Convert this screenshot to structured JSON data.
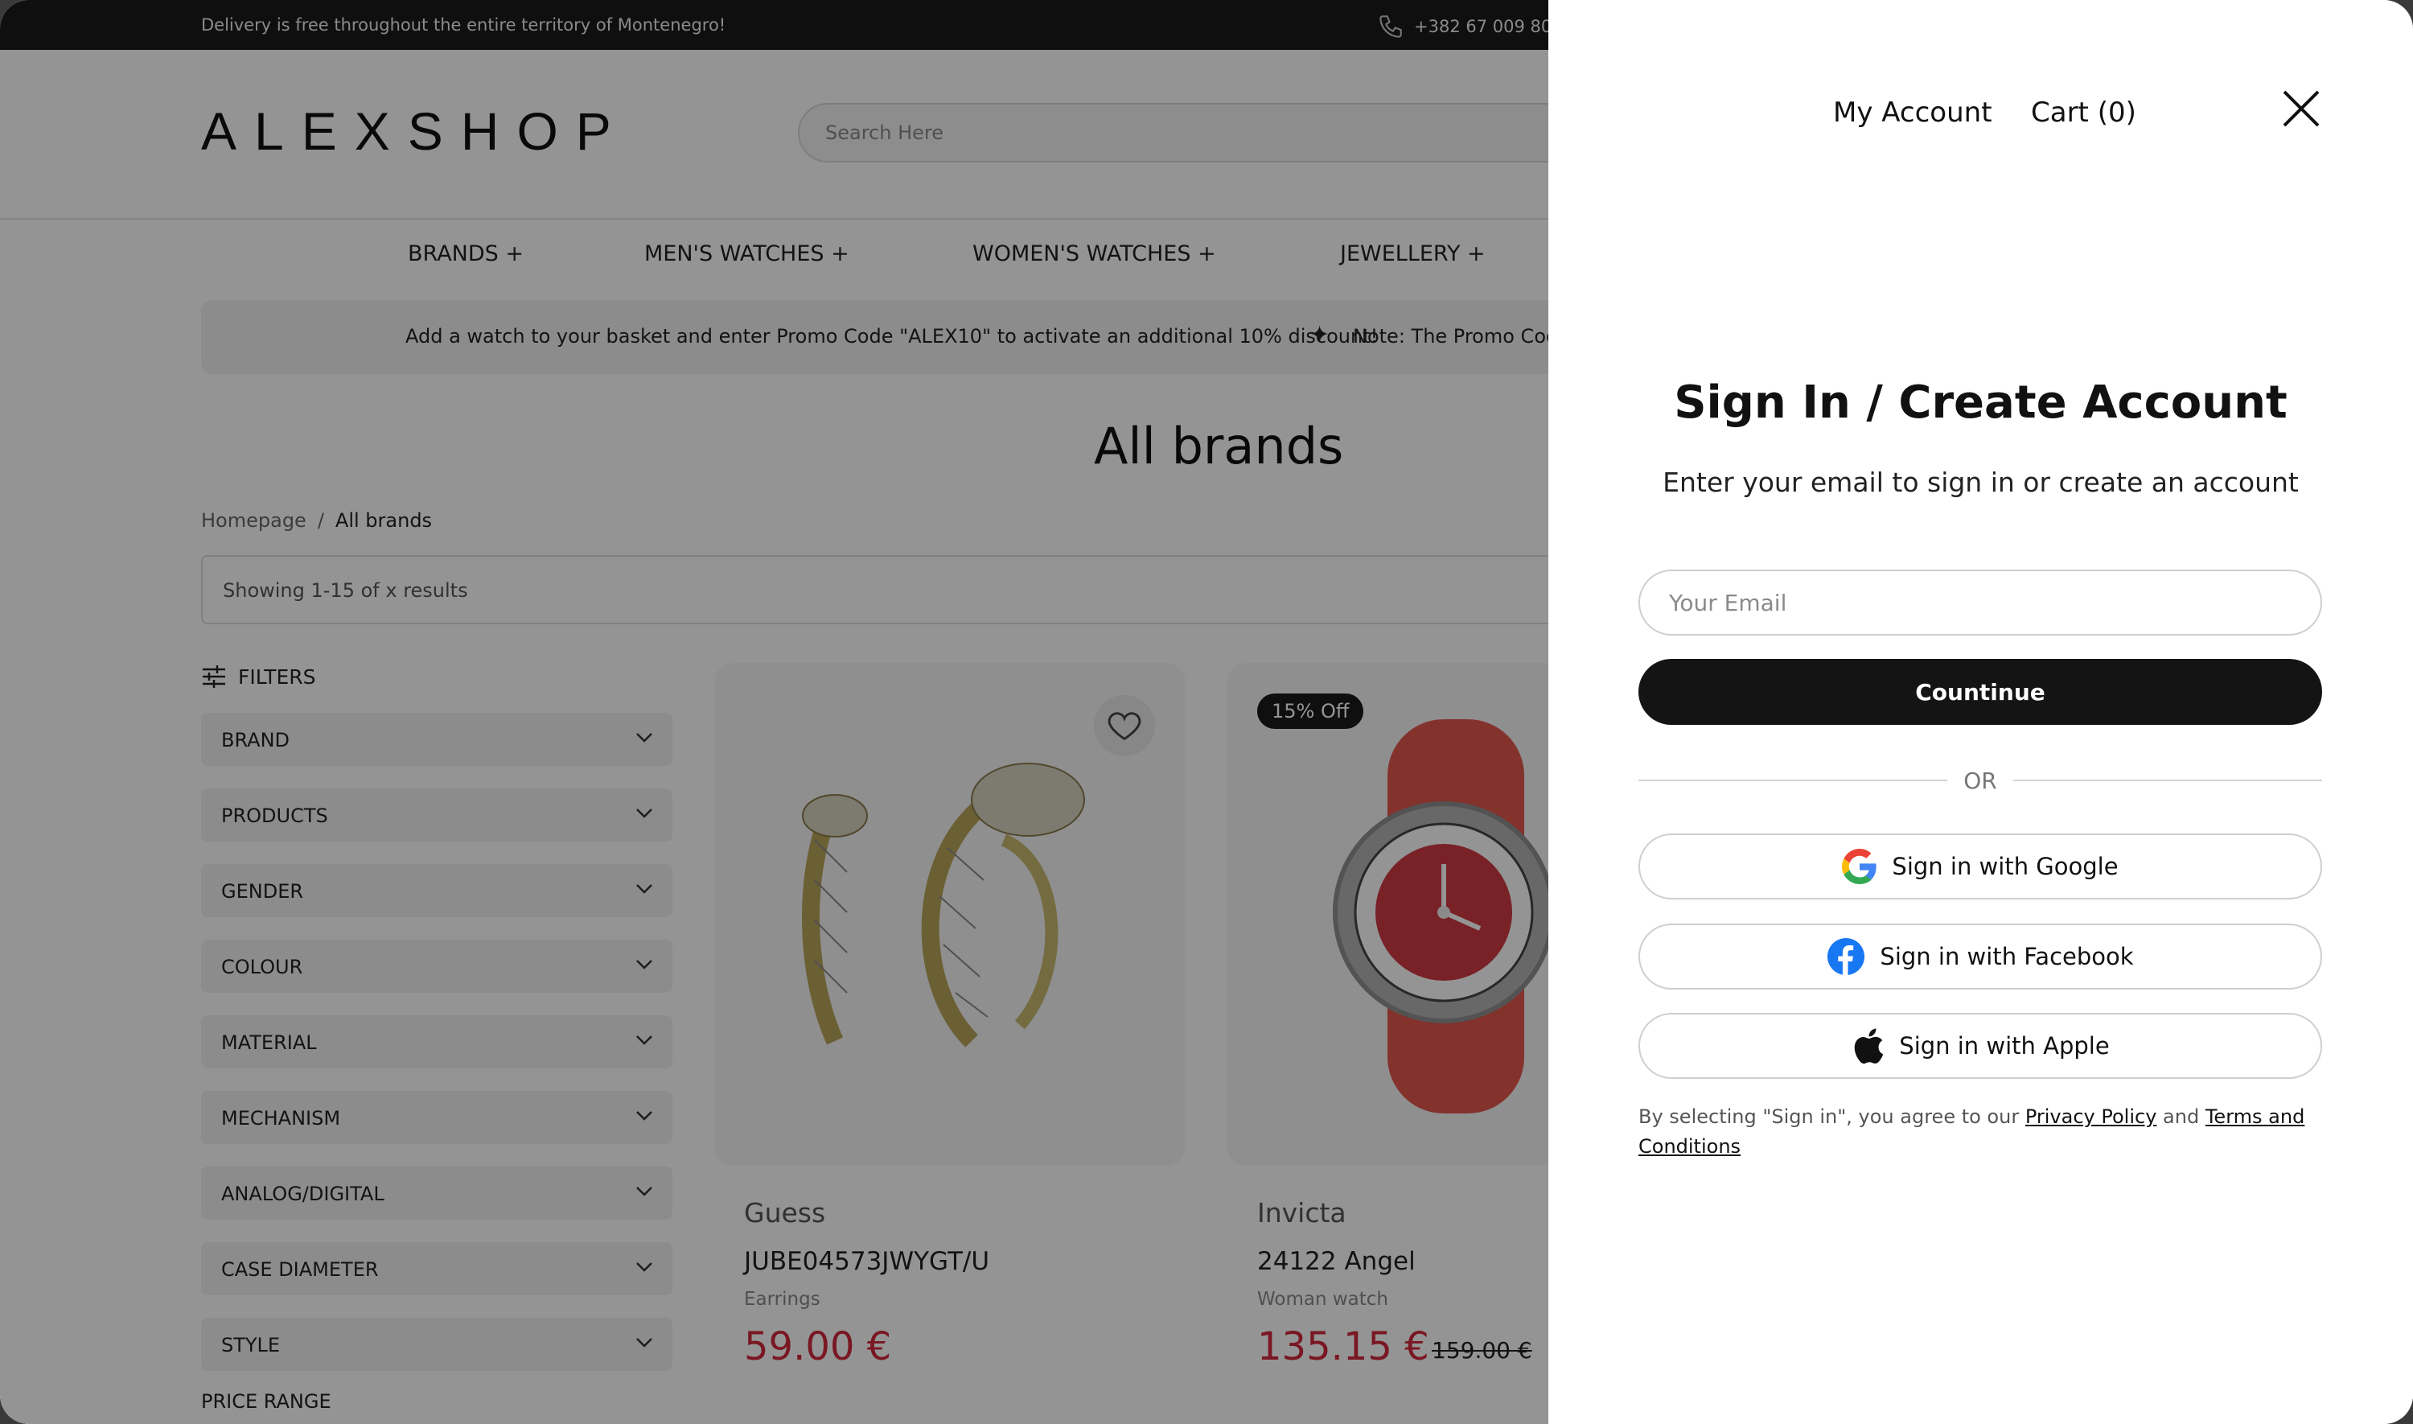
{
  "topbar": {
    "delivery": "Delivery is free throughout the entire territory of Montenegro!",
    "phone": "+382 67 009 80"
  },
  "header": {
    "logo": "ALEXSHOP",
    "search_placeholder": "Search Here"
  },
  "menu": {
    "items": [
      "BRANDS +",
      "MEN'S WATCHES +",
      "WOMEN'S WATCHES +",
      "JEWELLERY +"
    ]
  },
  "promo": {
    "message": "Add a watch to your basket and enter Promo Code \"ALEX10\" to activate an additional 10% discount!",
    "note": "Note: The Promo Cod"
  },
  "page": {
    "title": "All brands",
    "breadcrumb": [
      "Homepage",
      "/",
      "All brands"
    ],
    "results": "Showing 1-15 of x results"
  },
  "filters": {
    "heading": "FILTERS",
    "items": [
      "BRAND",
      "PRODUCTS",
      "GENDER",
      "COLOUR",
      "MATERIAL",
      "MECHANISM",
      "ANALOG/DIGITAL",
      "CASE DIAMETER",
      "STYLE"
    ],
    "price_range": "PRICE RANGE"
  },
  "products": [
    {
      "brand": "Guess",
      "model": "JUBE04573JWYGT/U",
      "category": "Earrings",
      "price": "59.00 €"
    },
    {
      "brand": "Invicta",
      "model": "24122 Angel",
      "category": "Woman watch",
      "price": "135.15 €",
      "old_price": "159.00 €",
      "badge": "15% Off"
    }
  ],
  "drawer": {
    "my_account": "My Account",
    "cart": "Cart (0)",
    "title": "Sign In / Create Account",
    "subtitle": "Enter your email to sign in or create an account",
    "email_placeholder": "Your Email",
    "continue": "Countinue",
    "or": "OR",
    "google": "Sign in with Google",
    "facebook": "Sign in with Facebook",
    "apple": "Sign in with Apple",
    "legal_prefix": "By selecting \"Sign in\", you agree to our",
    "privacy": "Privacy Policy",
    "and": "and",
    "terms": "Terms and Conditions"
  }
}
